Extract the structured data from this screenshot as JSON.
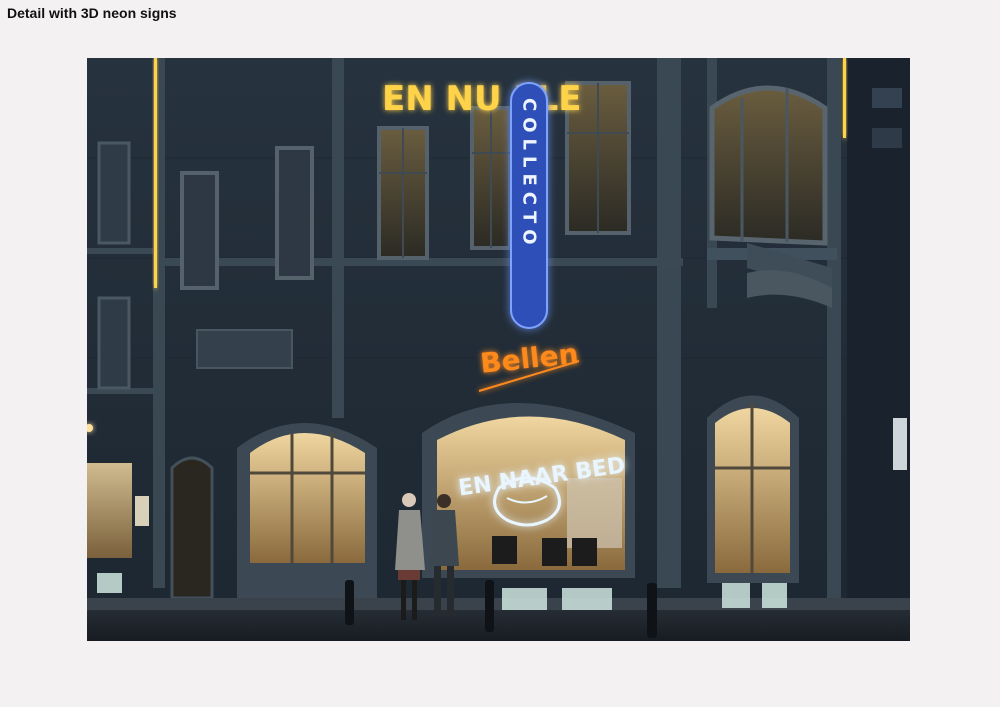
{
  "page": {
    "title": "Detail with 3D neon signs"
  },
  "photo": {
    "description_icon": "photo-image",
    "signs": {
      "top_sign": "EN NU ELE",
      "vertical_sign": "COLLECTO",
      "middle_sign": "Bellen",
      "window_sign": "EN NAAR BED"
    },
    "colors": {
      "sky": "#1b2530",
      "brick": "#25313d",
      "stone": "#3c4a55",
      "window_glow": "#d9b77a",
      "neon_yellow": "#ffd34a",
      "neon_blue": "#3b6cff",
      "neon_orange": "#ff8a1f",
      "neon_white": "#e9f6ff",
      "street": "#1a1f26",
      "sidewalk": "#2a3038"
    }
  }
}
